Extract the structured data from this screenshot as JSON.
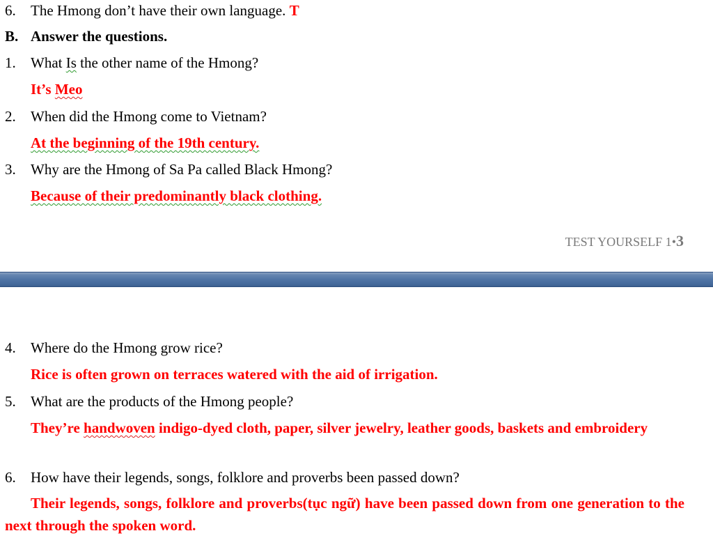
{
  "top_page": {
    "q6_number": "6.",
    "q6_text": "The Hmong don’t have their own language.",
    "q6_answer": "T",
    "section_b": "B.",
    "section_b_title": "Answer the questions.",
    "questions": [
      {
        "number": "1.",
        "q_pre": "What",
        "q_squiggle": "Is",
        "q_post": "the other name of the Hmong?",
        "a_pre": "It’s",
        "a_squiggle": "Meo"
      },
      {
        "number": "2.",
        "question": "When did the Hmong come to Vietnam?",
        "answer": "At the beginning of the 19th century."
      },
      {
        "number": "3.",
        "question": "Why are the Hmong of Sa Pa called Black Hmong?",
        "answer": "Because of their predominantly black clothing."
      }
    ],
    "footer_text": "TEST YOURSELF 1",
    "footer_dot": "•",
    "footer_page": "3"
  },
  "bottom_page": {
    "questions": [
      {
        "number": "4.",
        "question": "Where do the Hmong grow rice?",
        "answer": "Rice is often grown on terraces watered with the aid of irrigation."
      },
      {
        "number": "5.",
        "question": "What are the products of the Hmong people?",
        "answer_pre": "They’re",
        "answer_squiggle": "handwoven",
        "answer_post": "indigo-dyed cloth, paper, silver jewelry, leather goods, baskets and embroidery"
      },
      {
        "number": "6.",
        "question": "How have their legends, songs, folklore and proverbs been passed down?",
        "answer": "Their legends, songs, folklore and proverbs(tục ngữ) have been passed down from one generation to the next through the spoken word."
      }
    ]
  }
}
